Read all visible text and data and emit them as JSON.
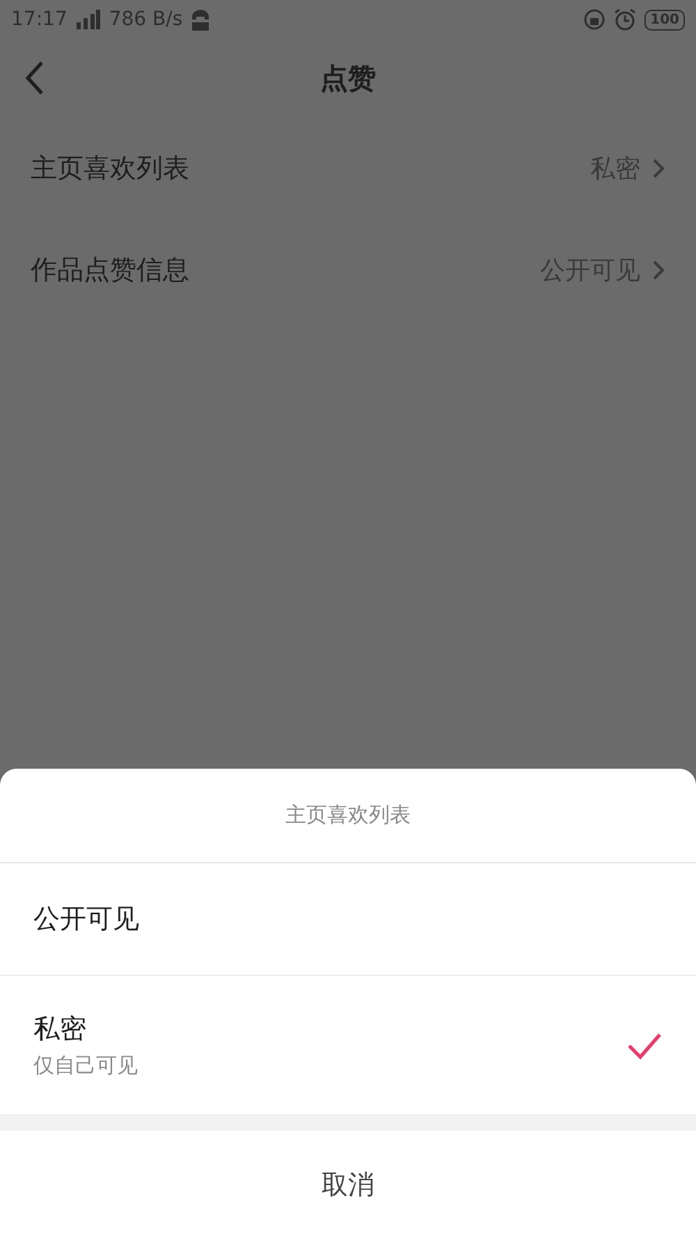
{
  "status_bar": {
    "time": "17:17",
    "speed": "786 B/s",
    "battery": "100"
  },
  "header": {
    "title": "点赞"
  },
  "settings": [
    {
      "label": "主页喜欢列表",
      "value": "私密"
    },
    {
      "label": "作品点赞信息",
      "value": "公开可见"
    }
  ],
  "sheet": {
    "title": "主页喜欢列表",
    "options": [
      {
        "label": "公开可见",
        "selected": false
      },
      {
        "label": "私密",
        "description": "仅自己可见",
        "selected": true
      }
    ],
    "cancel": "取消"
  }
}
